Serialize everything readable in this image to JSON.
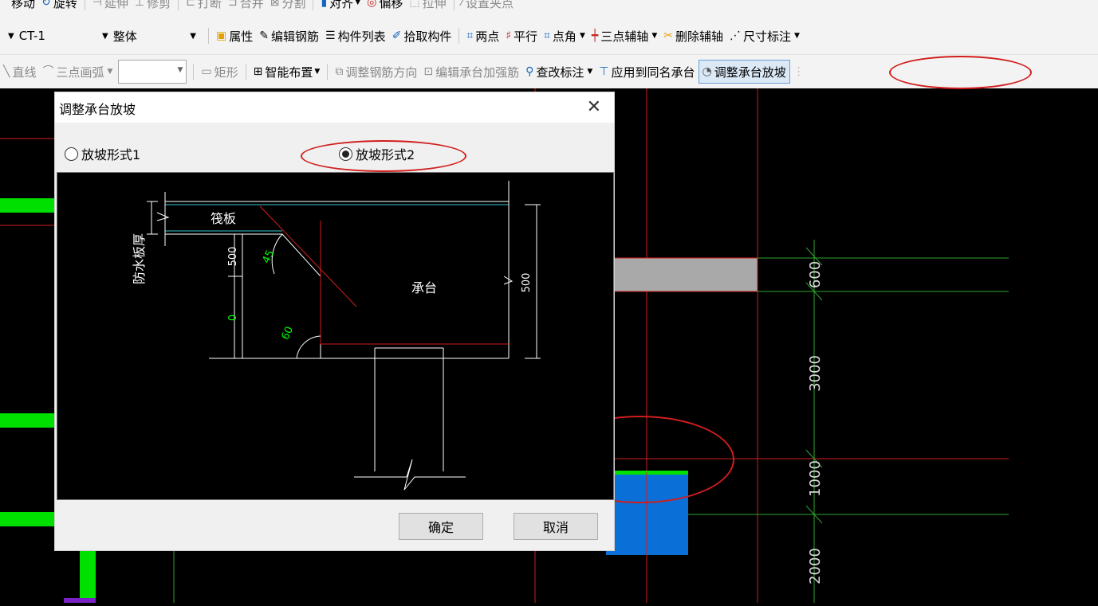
{
  "toolbar_row1": {
    "items": [
      "移动",
      "旋转",
      "延伸",
      "修剪",
      "打断",
      "合并",
      "分割",
      "对齐",
      "偏移",
      "拉伸",
      "设置夹点"
    ]
  },
  "toolbar_row2": {
    "component_combo": "CT-1",
    "scope_combo": "整体",
    "properties": "属性",
    "edit_rebar": "编辑钢筋",
    "component_list": "构件列表",
    "pick_component": "拾取构件",
    "two_points": "两点",
    "parallel": "平行",
    "point_angle": "点角",
    "three_point_axis": "三点辅轴",
    "delete_axis": "删除辅轴",
    "dimension": "尺寸标注"
  },
  "toolbar_row3": {
    "line": "直线",
    "three_point_arc": "三点画弧",
    "rectangle": "矩形",
    "smart_layout": "智能布置",
    "adjust_rebar_direction": "调整钢筋方向",
    "edit_cap_rebar": "编辑承台加强筋",
    "check_annotation": "查改标注",
    "apply_same_name": "应用到同名承台",
    "adjust_slope": "调整承台放坡"
  },
  "canvas": {
    "dims": [
      "600",
      "3000",
      "1000",
      "2000"
    ]
  },
  "dialog": {
    "title": "调整承台放坡",
    "option1": "放坡形式1",
    "option2": "放坡形式2",
    "selected": "option2",
    "diagram": {
      "raft": "筏板",
      "cap": "承台",
      "waterproof": "防水板厚",
      "dim_500_left": "500",
      "dim_0": "0",
      "angle_45": "45",
      "angle_60": "60",
      "dim_500_right": "500"
    },
    "ok": "确定",
    "cancel": "取消"
  },
  "colors": {
    "green_bar": "#00e000",
    "blue_block": "#0a6fd6",
    "red_line": "#d21d1d",
    "grid_green": "#2fa52f",
    "dim_green": "#00ff00"
  }
}
